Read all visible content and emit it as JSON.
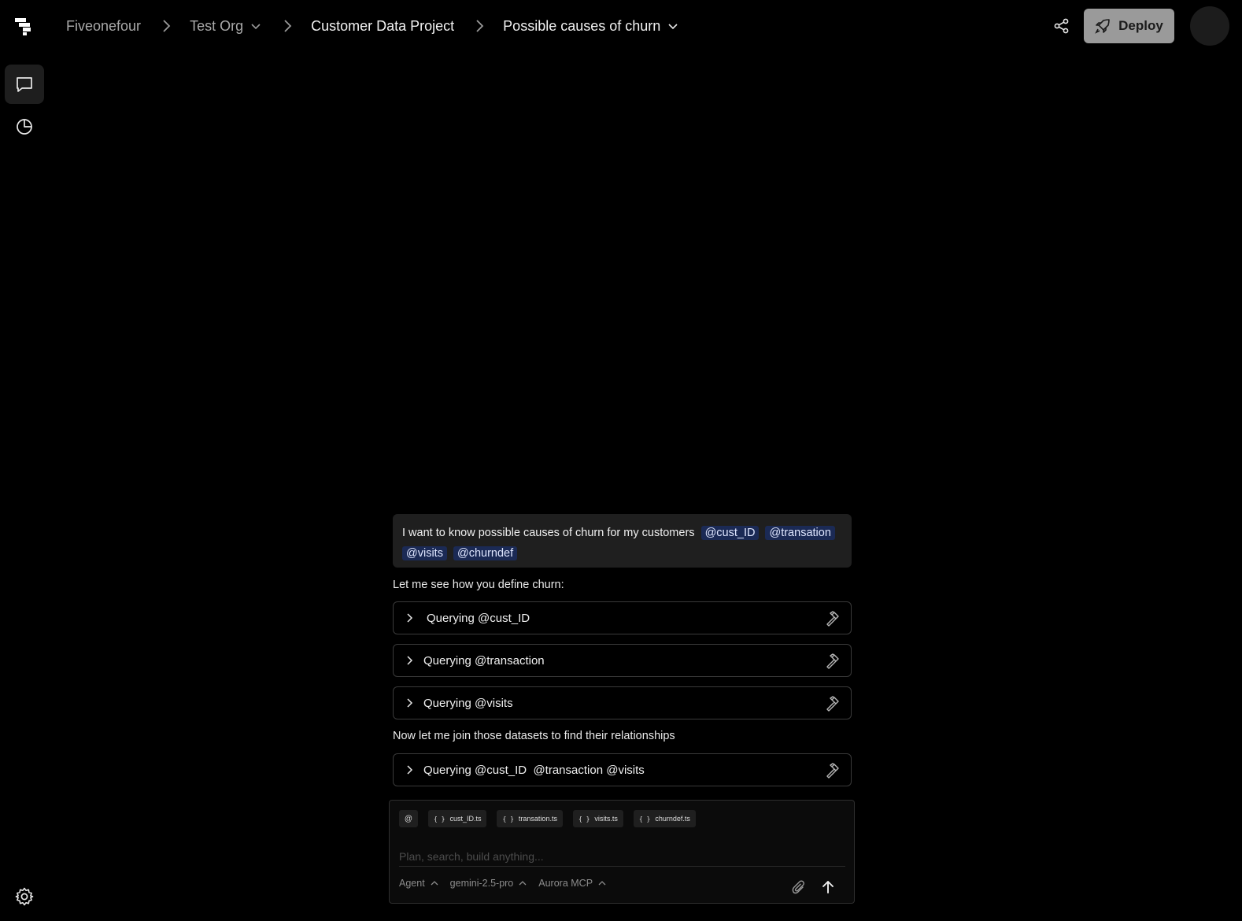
{
  "breadcrumb": {
    "org_root": "Fiveonefour",
    "org": "Test Org",
    "project": "Customer Data Project",
    "thread": "Possible causes of churn"
  },
  "header": {
    "deploy_label": "Deploy"
  },
  "conversation": {
    "user_message": {
      "text": "I want to know possible causes of churn for my customers",
      "mentions": [
        "@cust_ID",
        "@transation",
        "@visits",
        "@churndef"
      ]
    },
    "assistant_intro": "Let me see how you define churn:",
    "queries": [
      "Querying @cust_ID",
      "Querying @transaction",
      "Querying @visits"
    ],
    "assistant_join": "Now let me join those datasets to find their relationships",
    "join_query": "Querying @cust_ID  @transaction @visits"
  },
  "composer": {
    "at_label": "@",
    "brace": "{ }",
    "files": [
      "cust_ID.ts",
      "transation.ts",
      "visits.ts",
      "churndef.ts"
    ],
    "placeholder": "Plan, search, build anything...",
    "mode": "Agent",
    "model": "gemini-2.5-pro",
    "mcp": "Aurora MCP"
  },
  "icons": {
    "logo": "fiveonefour-logo-icon",
    "chat": "chat-icon",
    "reports": "pie-chart-icon",
    "settings": "gear-icon",
    "share": "share-icon",
    "deploy": "rocket-icon",
    "tool": "hammer-icon",
    "attach": "paperclip-icon",
    "send": "arrow-up-icon"
  },
  "colors": {
    "background": "#000000",
    "mention_bg": "#1b2a55",
    "deploy_bg": "#9a9a9a",
    "panel": "#1f1f1f"
  }
}
